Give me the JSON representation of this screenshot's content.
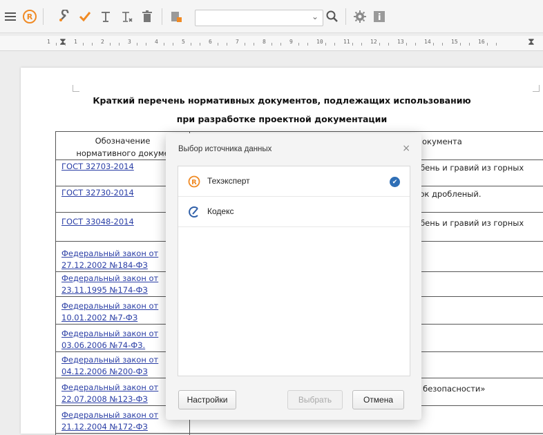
{
  "toolbar": {
    "icons": [
      "menu-icon",
      "techexpert-logo-icon",
      "wrench-icon",
      "check-icon",
      "text-format-icon",
      "clear-format-icon",
      "delete-icon",
      "insert-icon",
      "search-icon",
      "settings-icon",
      "info-icon"
    ],
    "combo_value": "",
    "accent_color": "#f08a24"
  },
  "ruler": {
    "labels": [
      "1",
      "1",
      "2",
      "3",
      "4",
      "5",
      "6",
      "7",
      "8",
      "9",
      "10",
      "11",
      "12",
      "13",
      "14",
      "15",
      "16"
    ]
  },
  "document": {
    "title_line1": "Краткий перечень нормативных документов, подлежащих использованию",
    "title_line2": "при разработке проектной документации",
    "header": {
      "col1": "Обозначение\nнормативного докуме",
      "col2": "окумента"
    },
    "rows": [
      {
        "code": "ГОСТ 32703-2014",
        "desc": "ебень и гравий из горных"
      },
      {
        "code": "ГОСТ 32730-2014",
        "desc": "сок дробленый."
      },
      {
        "code": "ГОСТ 33048-2014",
        "desc": "ебень и гравий из горных"
      },
      {
        "code": "Федеральный закон от\n27.12.2002 №184-ФЗ",
        "desc": ""
      },
      {
        "code": "Федеральный закон от\n23.11.1995 №174-ФЗ",
        "desc": ""
      },
      {
        "code": "Федеральный закон от\n10.01.2002 №7-ФЗ",
        "desc": ""
      },
      {
        "code": "Федеральный закон от\n03.06.2006 №74-ФЗ.",
        "desc": ""
      },
      {
        "code": "Федеральный закон от\n04.12.2006 №200-ФЗ",
        "desc": ""
      },
      {
        "code": "Федеральный закон от\n22.07.2008 №123-ФЗ",
        "desc": "й безопасности»"
      },
      {
        "code": "Федеральный закон от\n21.12.2004 №172-ФЗ",
        "desc": "»"
      }
    ]
  },
  "dialog": {
    "title": "Выбор источника данных",
    "close_label": "×",
    "items": [
      {
        "label": "Техэксперт",
        "icon": "techexpert-logo-icon",
        "selected": true
      },
      {
        "label": "Кодекс",
        "icon": "kodeks-logo-icon",
        "selected": false
      }
    ],
    "settings_button": "Настройки",
    "choose_button": "Выбрать",
    "cancel_button": "Отмена"
  }
}
